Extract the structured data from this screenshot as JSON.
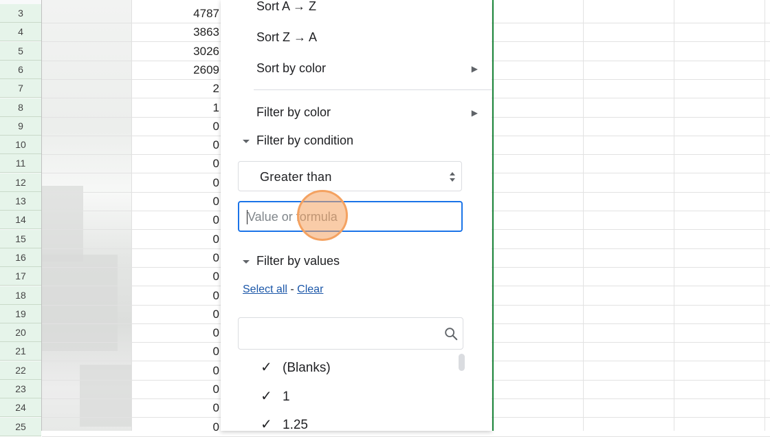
{
  "rows": [
    {
      "num": "3",
      "value": "4787"
    },
    {
      "num": "4",
      "value": "3863"
    },
    {
      "num": "5",
      "value": "3026"
    },
    {
      "num": "6",
      "value": "2609"
    },
    {
      "num": "7",
      "value": "2"
    },
    {
      "num": "8",
      "value": "1"
    },
    {
      "num": "9",
      "value": "0"
    },
    {
      "num": "10",
      "value": "0"
    },
    {
      "num": "11",
      "value": "0"
    },
    {
      "num": "12",
      "value": "0"
    },
    {
      "num": "13",
      "value": "0"
    },
    {
      "num": "14",
      "value": "0"
    },
    {
      "num": "15",
      "value": "0"
    },
    {
      "num": "16",
      "value": "0"
    },
    {
      "num": "17",
      "value": "0"
    },
    {
      "num": "18",
      "value": "0"
    },
    {
      "num": "19",
      "value": "0"
    },
    {
      "num": "20",
      "value": "0"
    },
    {
      "num": "21",
      "value": "0"
    },
    {
      "num": "22",
      "value": "0"
    },
    {
      "num": "23",
      "value": "0"
    },
    {
      "num": "24",
      "value": "0"
    },
    {
      "num": "25",
      "value": "0"
    }
  ],
  "menu": {
    "sort_az": "Sort A → Z",
    "sort_za": "Sort Z → A",
    "sort_by_color": "Sort by color",
    "filter_by_color": "Filter by color",
    "filter_by_condition": "Filter by condition",
    "condition_selected": "Greater than",
    "condition_input_placeholder": "Value or formula",
    "filter_by_values": "Filter by values",
    "select_all": "Select all",
    "separator": "-",
    "clear": "Clear",
    "values": [
      "(Blanks)",
      "1",
      "1.25"
    ]
  },
  "colors": {
    "accent": "#1a73e8",
    "selected_green": "#1e8e3e",
    "click_highlight": "#f4a261"
  }
}
